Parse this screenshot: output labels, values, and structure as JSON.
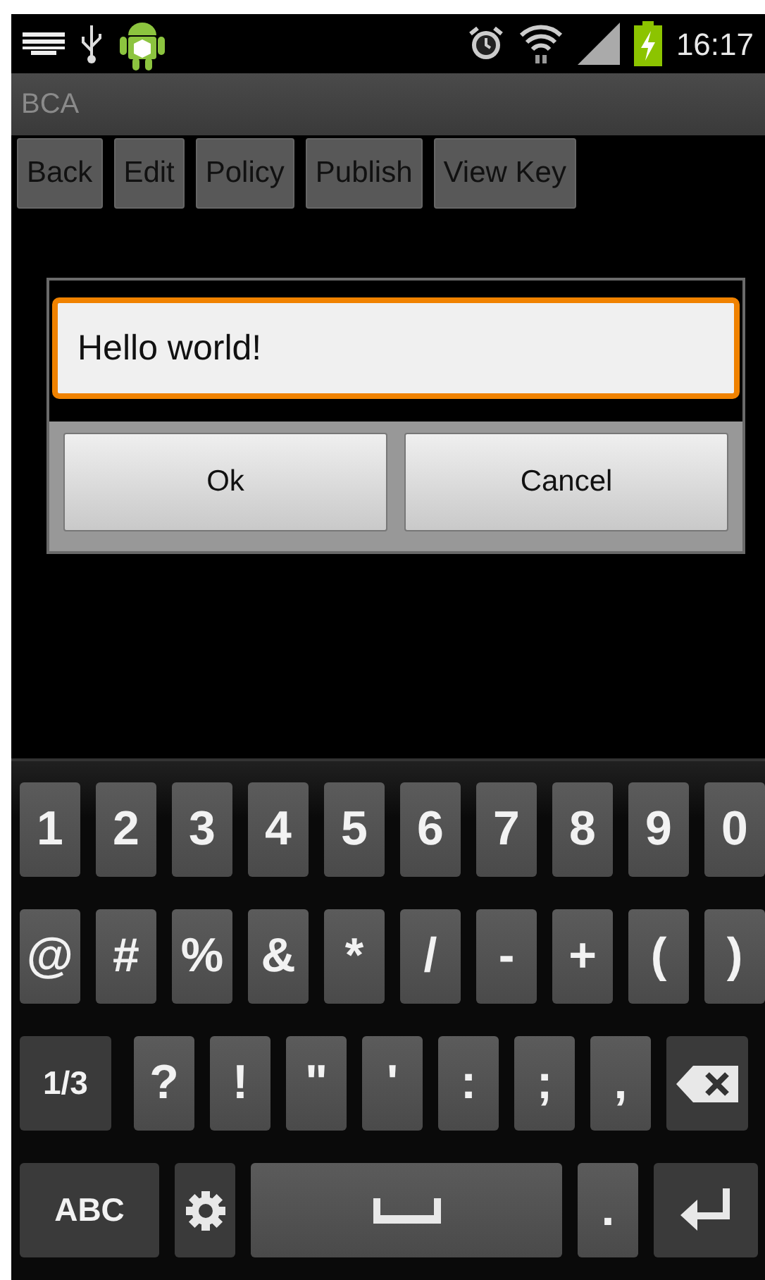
{
  "status_bar": {
    "time": "16:17"
  },
  "app_bar": {
    "title": "BCA"
  },
  "toolbar": {
    "buttons": [
      "Back",
      "Edit",
      "Policy",
      "Publish",
      "View Key"
    ]
  },
  "dialog": {
    "input": {
      "value": "Hello world!",
      "focused": true
    },
    "buttons": [
      "Ok",
      "Cancel"
    ]
  },
  "keyboard": {
    "rows": [
      [
        {
          "kind": "char",
          "label": "1"
        },
        {
          "kind": "char",
          "label": "2"
        },
        {
          "kind": "char",
          "label": "3"
        },
        {
          "kind": "char",
          "label": "4"
        },
        {
          "kind": "char",
          "label": "5"
        },
        {
          "kind": "char",
          "label": "6"
        },
        {
          "kind": "char",
          "label": "7"
        },
        {
          "kind": "char",
          "label": "8"
        },
        {
          "kind": "char",
          "label": "9"
        },
        {
          "kind": "char",
          "label": "0"
        }
      ],
      [
        {
          "kind": "char",
          "label": "@"
        },
        {
          "kind": "char",
          "label": "#"
        },
        {
          "kind": "char",
          "label": "%"
        },
        {
          "kind": "char",
          "label": "&"
        },
        {
          "kind": "char",
          "label": "*"
        },
        {
          "kind": "char",
          "label": "/"
        },
        {
          "kind": "char",
          "label": "-"
        },
        {
          "kind": "char",
          "label": "+"
        },
        {
          "kind": "char",
          "label": "("
        },
        {
          "kind": "char",
          "label": ")"
        }
      ],
      [
        {
          "kind": "function",
          "label": "1/3"
        },
        {
          "kind": "char",
          "label": "?"
        },
        {
          "kind": "char",
          "label": "!"
        },
        {
          "kind": "char",
          "label": "\""
        },
        {
          "kind": "char",
          "label": "'"
        },
        {
          "kind": "char",
          "label": ":"
        },
        {
          "kind": "char",
          "label": ";"
        },
        {
          "kind": "char",
          "label": ","
        },
        {
          "kind": "backspace"
        }
      ],
      [
        {
          "kind": "function",
          "label": "ABC"
        },
        {
          "kind": "settings"
        },
        {
          "kind": "space"
        },
        {
          "kind": "char",
          "label": "."
        },
        {
          "kind": "enter"
        }
      ]
    ]
  }
}
